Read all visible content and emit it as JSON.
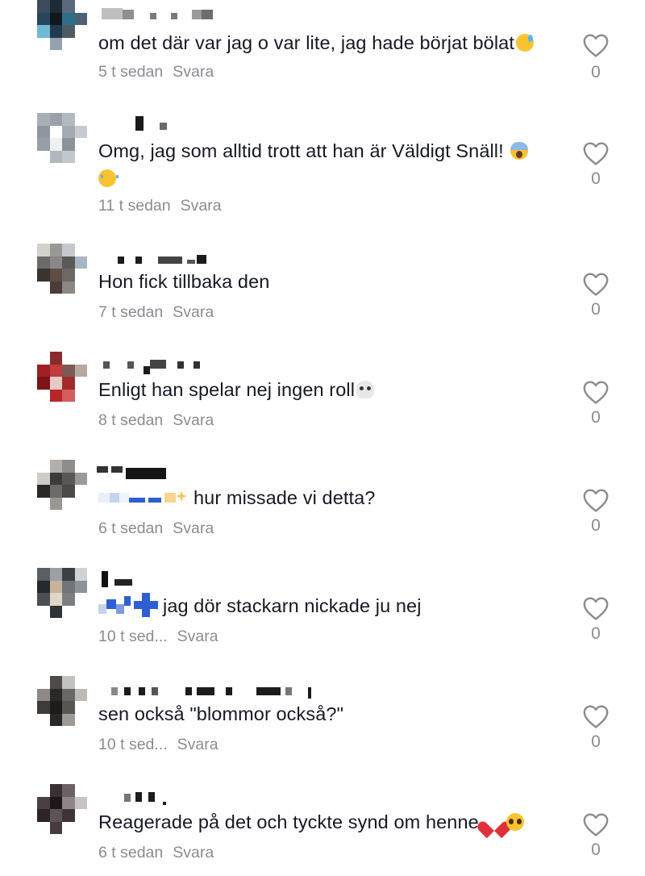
{
  "comments": [
    {
      "text": "om det där var jag o var lite, jag hade börjat bölat",
      "time": "5 t sedan",
      "reply": "Svara",
      "likes": "0"
    },
    {
      "text": "Omg, jag som alltid trott att han är Väldigt Snäll!",
      "time": "11 t sedan",
      "reply": "Svara",
      "likes": "0"
    },
    {
      "text": "Hon fick tillbaka den",
      "time": "7 t sedan",
      "reply": "Svara",
      "likes": "0"
    },
    {
      "text": "Enligt han spelar nej ingen roll",
      "time": "8 t sedan",
      "reply": "Svara",
      "likes": "0"
    },
    {
      "text": "hur missade vi detta?",
      "time": "6 t sedan",
      "reply": "Svara",
      "likes": "0"
    },
    {
      "text": "jag dör stackarn nickade ju nej",
      "time": "10 t sed...",
      "reply": "Svara",
      "likes": "0"
    },
    {
      "text": "sen också \"blommor också?\"",
      "time": "10 t sed...",
      "reply": "Svara",
      "likes": "0"
    },
    {
      "text": "Reagerade på det och tyckte synd om henne",
      "time": "6 t sedan",
      "reply": "Svara",
      "likes": "0"
    }
  ],
  "icons": {
    "like": "heart-outline-icon"
  },
  "colors": {
    "text": "#161823",
    "meta": "#8a8b91",
    "background": "#ffffff"
  }
}
